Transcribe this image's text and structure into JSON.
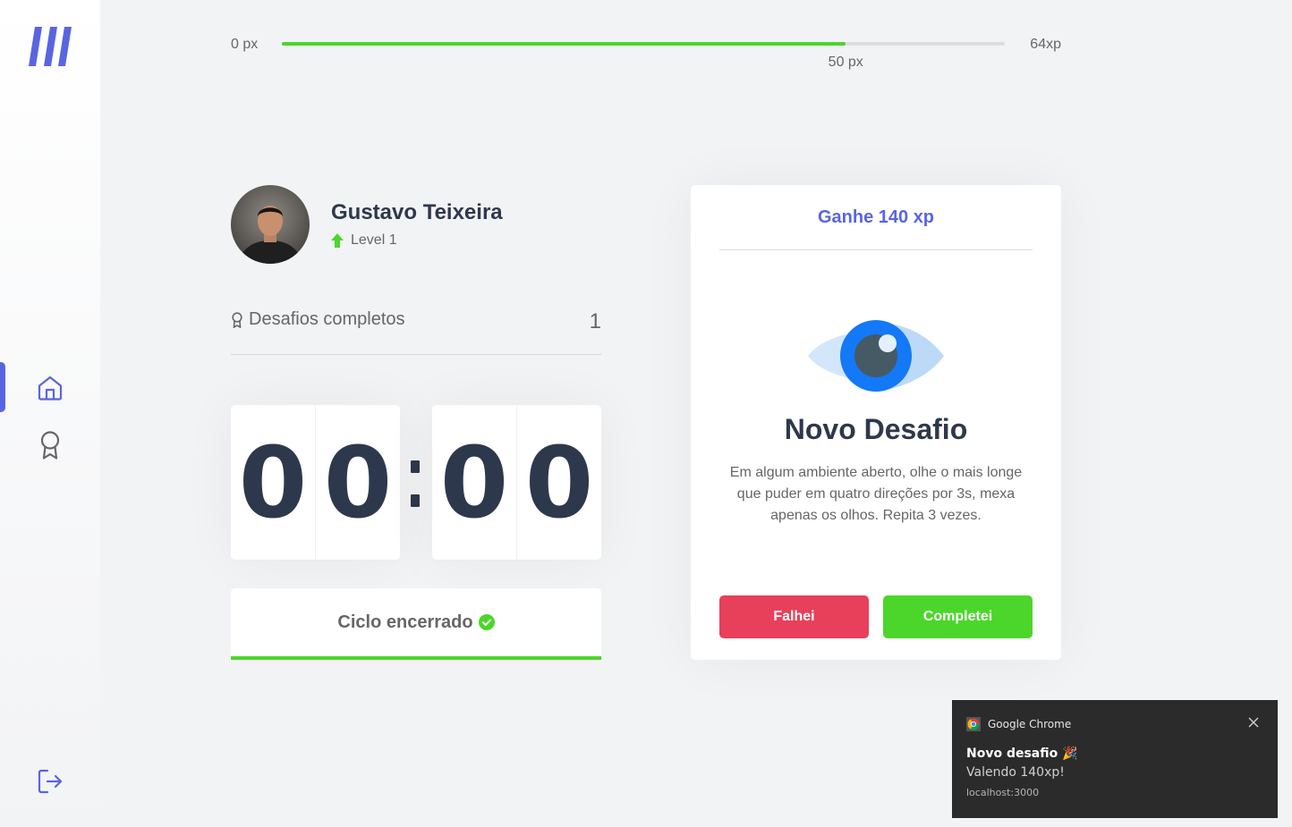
{
  "colors": {
    "accent": "#5965e0",
    "success": "#4cd62b",
    "danger": "#e83f5b",
    "title": "#2e384d",
    "text": "#666666",
    "background": "#f2f3f5"
  },
  "sidebar": {
    "logo_icon": "moveit-logo",
    "items": [
      {
        "icon": "home-icon",
        "active": true
      },
      {
        "icon": "award-icon",
        "active": false
      }
    ],
    "logout_icon": "logout-icon"
  },
  "xp_bar": {
    "min_label": "0 px",
    "max_label": "64xp",
    "current_label": "50 px",
    "progress_percent": 78
  },
  "profile": {
    "name": "Gustavo Teixeira",
    "level_label": "Level 1"
  },
  "completed_challenges": {
    "label": "Desafios completos",
    "count": "1"
  },
  "countdown": {
    "minute_left": "0",
    "minute_right": "0",
    "second_left": "0",
    "second_right": "0"
  },
  "cycle_button": {
    "label": "Ciclo encerrado"
  },
  "challenge": {
    "header": "Ganhe 140 xp",
    "icon": "eye-icon",
    "title": "Novo Desafio",
    "description": "Em algum ambiente aberto, olhe o mais longe que puder em quatro direções por 3s, mexa apenas os olhos. Repita 3 vezes.",
    "fail_label": "Falhei",
    "complete_label": "Completei"
  },
  "notification": {
    "app_name": "Google Chrome",
    "title": "Novo desafio 🎉",
    "body": "Valendo 140xp!",
    "source": "localhost:3000"
  }
}
